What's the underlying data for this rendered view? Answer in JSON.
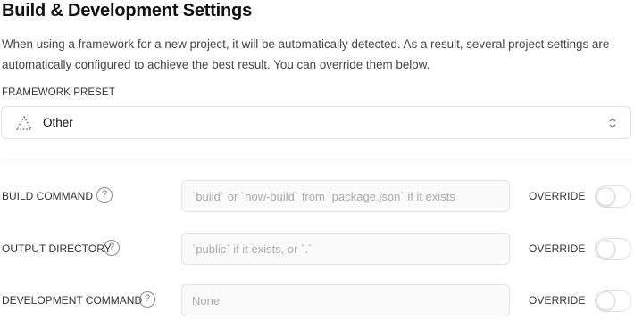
{
  "section": {
    "title": "Build & Development Settings",
    "description": "When using a framework for a new project, it will be automatically detected. As a result, several project settings are automatically configured to achieve the best result. You can override them below."
  },
  "framework_preset": {
    "label": "FRAMEWORK PRESET",
    "selected": "Other",
    "icon": "triangle-dotted-icon"
  },
  "settings": [
    {
      "label": "BUILD COMMAND",
      "placeholder": "`build` or `now-build` from `package.json` if it exists",
      "override_label": "OVERRIDE",
      "override_enabled": false
    },
    {
      "label": "OUTPUT DIRECTORY",
      "placeholder": "`public` if it exists, or `.`",
      "override_label": "OVERRIDE",
      "override_enabled": false
    },
    {
      "label": "DEVELOPMENT COMMAND",
      "placeholder": "None",
      "override_label": "OVERRIDE",
      "override_enabled": false
    }
  ],
  "help_glyph": "?"
}
